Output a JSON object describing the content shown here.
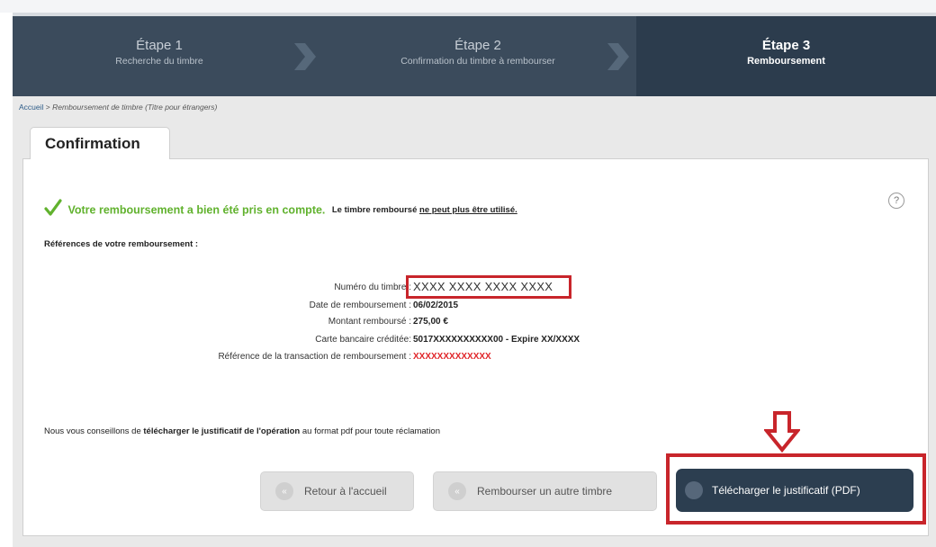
{
  "steps": [
    {
      "title": "Étape 1",
      "subtitle": "Recherche du timbre"
    },
    {
      "title": "Étape 2",
      "subtitle": "Confirmation du timbre à rembourser"
    },
    {
      "title": "Étape 3",
      "subtitle": "Remboursement"
    }
  ],
  "breadcrumb": {
    "home": "Accueil",
    "separator": ">",
    "current": "Remboursement de timbre (Titre pour étrangers)"
  },
  "tab": {
    "label": "Confirmation"
  },
  "confirmation": {
    "success_message": "Votre remboursement a bien été pris en compte.",
    "note_prefix": "Le timbre remboursé",
    "note_link": "ne peut plus être utilisé.",
    "help_label": "?"
  },
  "references": {
    "title": "Références de votre remboursement :",
    "rows": [
      {
        "label": "Numéro du timbre :",
        "value": "XXXX XXXX XXXX XXXX"
      },
      {
        "label": "Date de remboursement :",
        "value": "06/02/2015"
      },
      {
        "label": "Montant remboursé :",
        "value": "275,00 €"
      },
      {
        "label": "Carte bancaire créditée:",
        "value": "5017XXXXXXXXXX00 - Expire  XX/XXXX"
      },
      {
        "label": "Référence de la transaction de remboursement :",
        "value": "XXXXXXXXXXXXX"
      }
    ]
  },
  "advice": {
    "prefix": "Nous vous conseillons de",
    "bold": "télécharger le justificatif de l'opération",
    "suffix": "au format pdf pour toute réclamation"
  },
  "buttons": {
    "home": {
      "label": "Retour à l'accueil",
      "icon": "«"
    },
    "other": {
      "label": "Rembourser un autre timbre",
      "icon": "«"
    },
    "pdf": {
      "label": "Télécharger le justificatif (PDF)"
    }
  },
  "colors": {
    "step_bar": "#3b4b5c",
    "step_active": "#2c3c4d",
    "success": "#61b22e",
    "highlight": "#c8252b",
    "transaction_ref": "#e0262a",
    "pdf_button": "#2c3e50"
  }
}
